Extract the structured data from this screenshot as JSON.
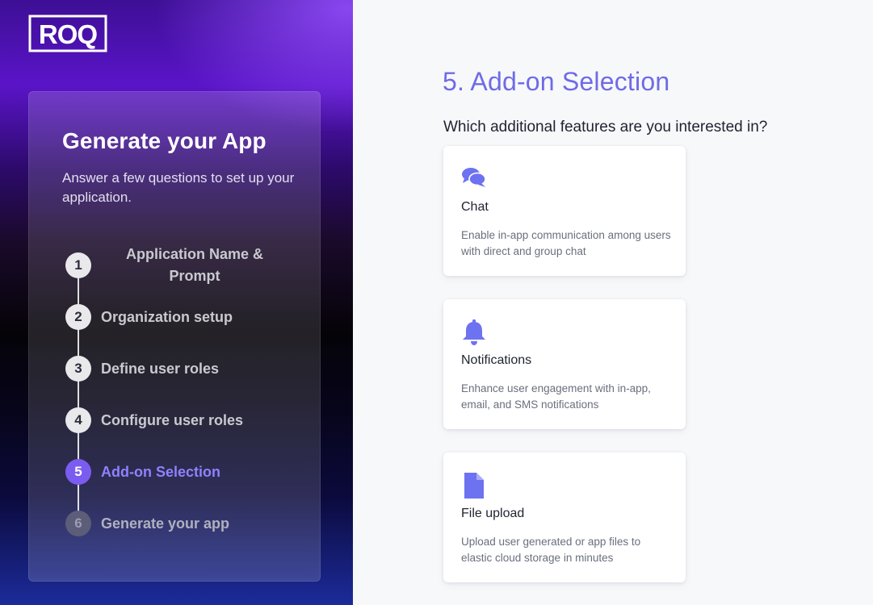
{
  "brand": {
    "logo_text": "ROQ"
  },
  "sidebar": {
    "title": "Generate your App",
    "subtitle": "Answer a few questions to set up your application.",
    "steps": [
      {
        "number": "1",
        "label": "Application Name & Prompt",
        "state": "completed"
      },
      {
        "number": "2",
        "label": "Organization setup",
        "state": "completed"
      },
      {
        "number": "3",
        "label": "Define user roles",
        "state": "completed"
      },
      {
        "number": "4",
        "label": "Configure user roles",
        "state": "completed"
      },
      {
        "number": "5",
        "label": "Add-on Selection",
        "state": "active"
      },
      {
        "number": "6",
        "label": "Generate your app",
        "state": "pending"
      }
    ]
  },
  "main": {
    "title": "5. Add-on Selection",
    "question": "Which additional features are you interested in?",
    "addons": [
      {
        "icon": "chat-bubbles-icon",
        "title": "Chat",
        "description": "Enable in-app communication among users with direct and group chat"
      },
      {
        "icon": "bell-icon",
        "title": "Notifications",
        "description": "Enhance user engagement with in-app, email, and SMS notifications"
      },
      {
        "icon": "file-icon",
        "title": "File upload",
        "description": "Upload user generated or app files to elastic cloud storage in minutes"
      }
    ]
  },
  "colors": {
    "accent": "#6f6be6",
    "active_step": "#7b5cf0",
    "icon": "#6d72f0"
  }
}
